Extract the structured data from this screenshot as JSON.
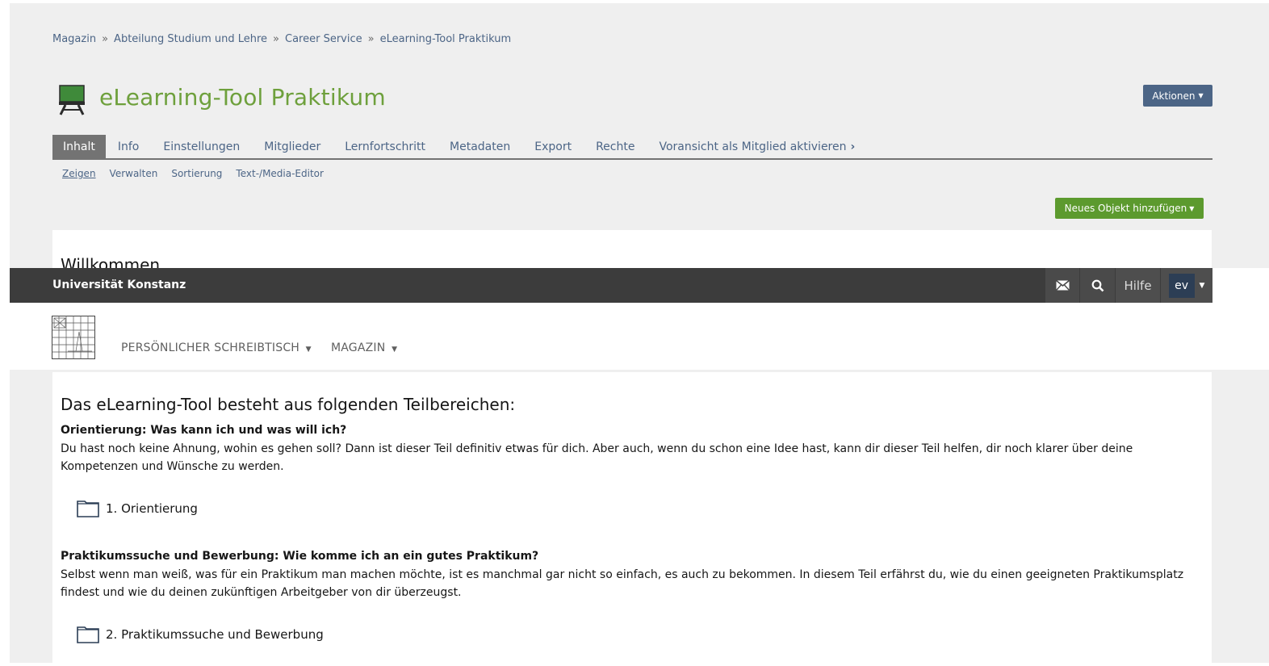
{
  "breadcrumb": [
    "Magazin",
    "Abteilung Studium und Lehre",
    "Career Service",
    "eLearning-Tool Praktikum"
  ],
  "breadcrumb_separator": "»",
  "page_title": "eLearning-Tool Praktikum",
  "actions_button": "Aktionen",
  "tabs": [
    "Inhalt",
    "Info",
    "Einstellungen",
    "Mitglieder",
    "Lernfortschritt",
    "Metadaten",
    "Export",
    "Rechte",
    "Voransicht als Mitglied aktivieren"
  ],
  "subtabs": [
    "Zeigen",
    "Verwalten",
    "Sortierung",
    "Text-/Media-Editor"
  ],
  "add_object_button": "Neues Objekt hinzufügen",
  "welcome_heading": "Willkommen",
  "topbar": {
    "university": "Universität Konstanz",
    "help": "Hilfe",
    "user_initials": "ev"
  },
  "mainnav": {
    "desk": "PERSÖNLICHER SCHREIBTISCH",
    "repository": "MAGAZIN"
  },
  "content": {
    "heading": "Das eLearning-Tool besteht aus folgenden Teilbereichen:",
    "sections": [
      {
        "title": "Orientierung: Was kann ich und was will ich?",
        "text": "Du hast noch keine Ahnung, wohin es gehen soll? Dann ist dieser Teil definitiv etwas für dich. Aber auch, wenn du schon eine Idee hast, kann dir dieser Teil helfen, dir noch klarer über deine Kompetenzen und Wünsche zu werden.",
        "folder": "1. Orientierung"
      },
      {
        "title": "Praktikumssuche und Bewerbung: Wie komme ich an ein gutes Praktikum?",
        "text": "Selbst wenn man weiß, was für ein Praktikum man machen möchte, ist es manchmal gar nicht so einfach, es auch zu bekommen. In diesem Teil erfährst du, wie du einen geeigneten Praktikumsplatz findest und wie du deinen zukünftigen Arbeitgeber von dir überzeugst.",
        "folder": "2. Praktikumssuche und Bewerbung"
      }
    ]
  },
  "colors": {
    "accent_green": "#6ea03c",
    "link_blue": "#4c6586",
    "topbar": "#3c3c3c",
    "add_button": "#5c9a2e"
  }
}
